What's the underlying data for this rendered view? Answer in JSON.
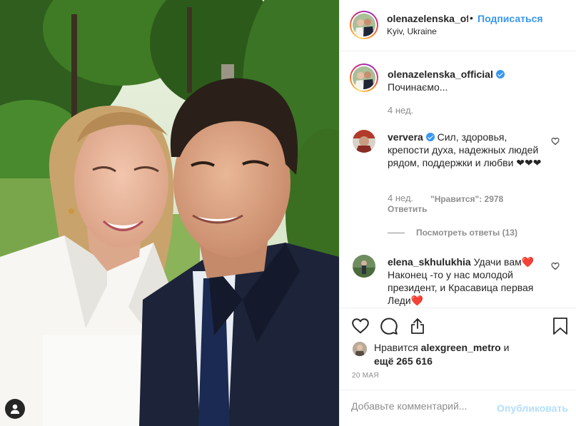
{
  "post": {
    "username": "olenazelenska_of",
    "follow_label": "Подписаться",
    "separator": "•",
    "location": "Kyiv, Ukraine"
  },
  "caption": {
    "username": "olenazelenska_official",
    "text": "Починаємо...",
    "time": "4 нед."
  },
  "comments": [
    {
      "username": "ververa",
      "text": "Сил, здоровья, крепости духа, надежных людей рядом, поддержки и любви ❤❤❤",
      "time": "4 нед.",
      "likes": "\"Нравится\": 2978",
      "reply": "Ответить",
      "view_replies": "Посмотреть ответы (13)"
    },
    {
      "username": "elena_skhulukhia",
      "text_part1": "Удачи вам",
      "text_part2": "Наконец -то у нас молодой президент, и Красавица первая Леди",
      "heart": "❤️"
    }
  ],
  "likes": {
    "prefix": "Нравится",
    "user": "alexgreen_metro",
    "suffix": "и",
    "others": "ещё 265 616"
  },
  "date": "20 МАЯ",
  "comment_box": {
    "placeholder": "Добавьте комментарий...",
    "publish_label": "Опубликовать"
  },
  "icons": [
    "heart-icon",
    "comment-icon",
    "share-icon",
    "bookmark-icon",
    "user-tag-icon",
    "verified-icon"
  ],
  "colors": {
    "link": "#3897f0",
    "meta": "#8e8e8e",
    "publish_disabled": "#b2dffc",
    "verified": "#3897f0"
  }
}
